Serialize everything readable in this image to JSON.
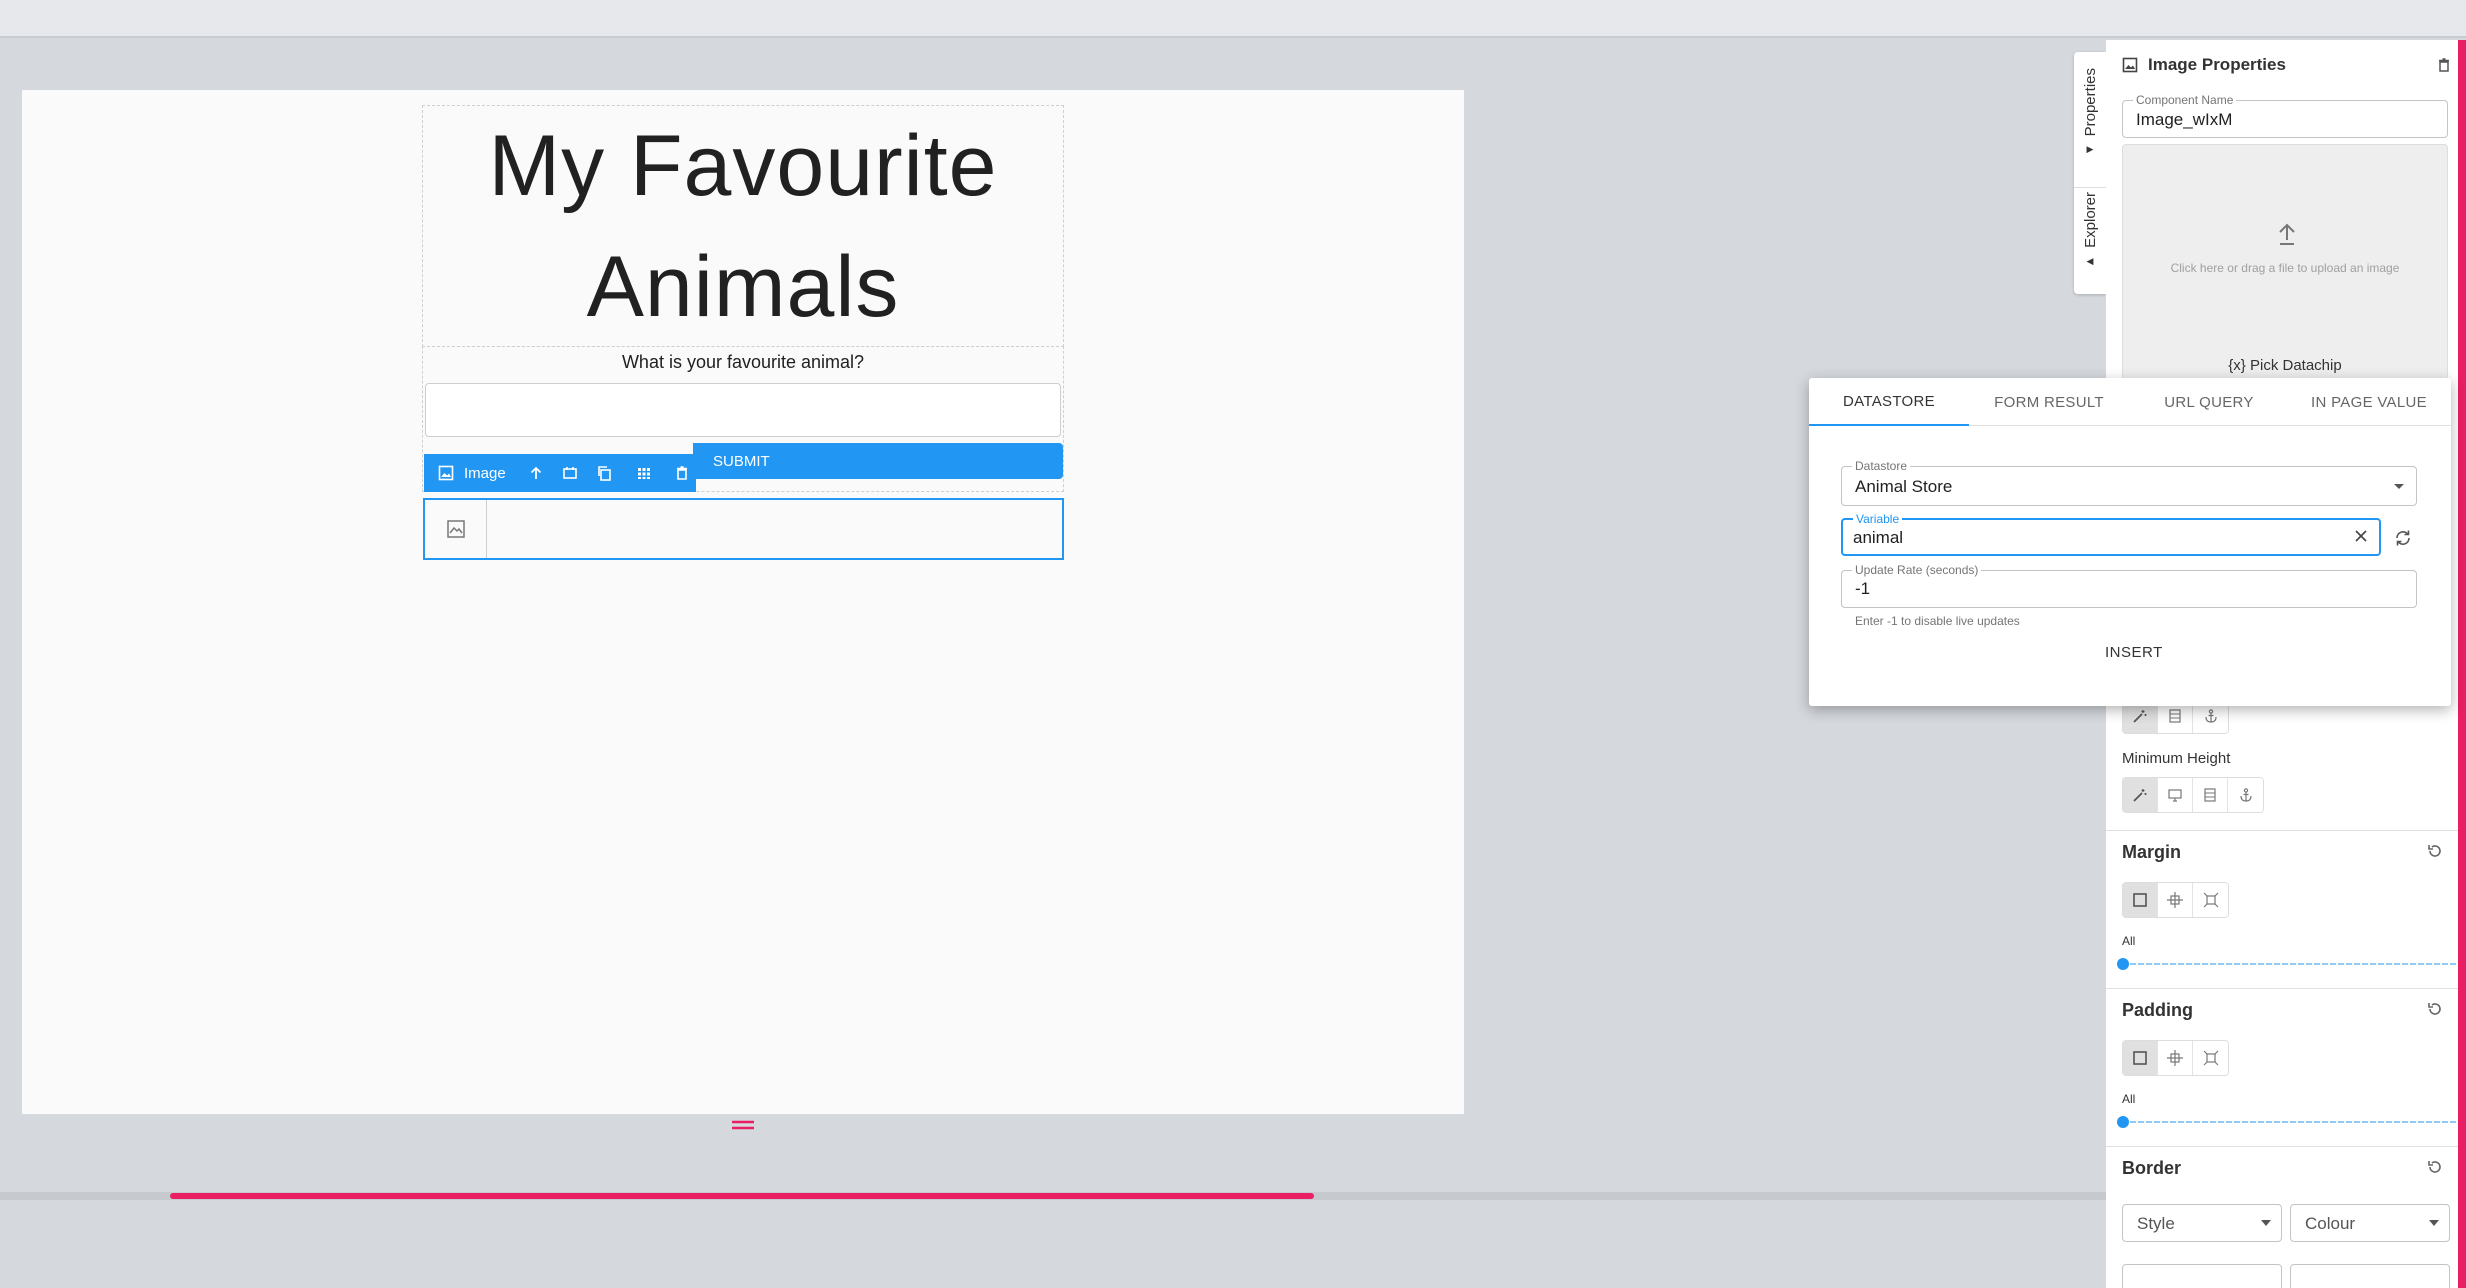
{
  "canvas": {
    "title": "My Favourite Animals",
    "question": "What is your favourite animal?",
    "submit_label": "SUBMIT",
    "image_toolbar_label": "Image"
  },
  "side_tabs": {
    "properties": "Properties",
    "explorer": "Explorer"
  },
  "panel": {
    "title": "Image Properties",
    "component_name_label": "Component Name",
    "component_name_value": "Image_wIxM",
    "upload_text": "Click here or drag a file to upload an image",
    "pick_datachip": "{x} Pick Datachip",
    "minimum_height_label": "Minimum Height",
    "margin_title": "Margin",
    "margin_all_label": "All",
    "padding_title": "Padding",
    "padding_all_label": "All",
    "border_title": "Border",
    "border_style_placeholder": "Style",
    "border_colour_placeholder": "Colour"
  },
  "popup": {
    "tabs": [
      "DATASTORE",
      "FORM RESULT",
      "URL QUERY",
      "IN PAGE VALUE"
    ],
    "active_tab": "DATASTORE",
    "datastore_label": "Datastore",
    "datastore_value": "Animal Store",
    "variable_label": "Variable",
    "variable_value": "animal",
    "update_rate_label": "Update Rate (seconds)",
    "update_rate_value": "-1",
    "helper_text": "Enter -1 to disable live updates",
    "insert_label": "INSERT"
  },
  "colors": {
    "accent": "#2196f3",
    "scrollbar": "#e91e63"
  }
}
